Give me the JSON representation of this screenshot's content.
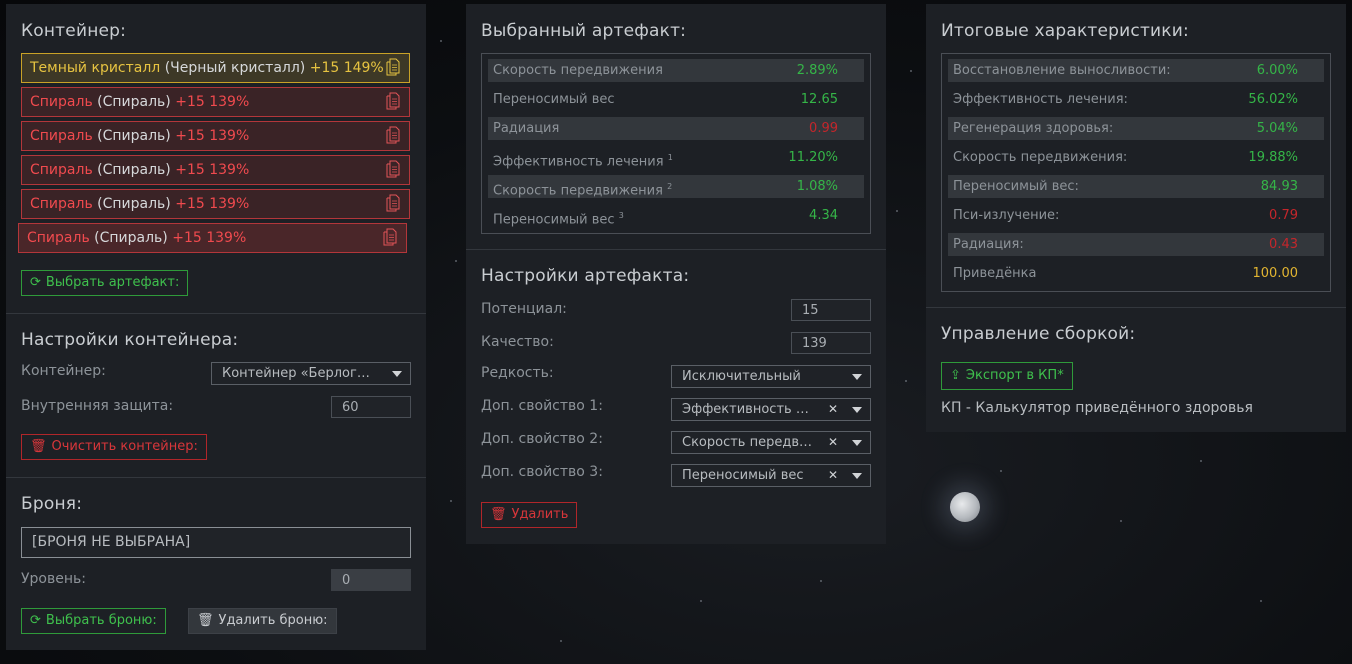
{
  "container": {
    "title": "Контейнер:",
    "items": [
      {
        "name": "Темный кристалл",
        "sub": "(Черный кристалл)",
        "pct": "+15 149%",
        "type": "gold"
      },
      {
        "name": "Спираль",
        "sub": "(Спираль)",
        "pct": "+15 139%",
        "type": "red"
      },
      {
        "name": "Спираль",
        "sub": "(Спираль)",
        "pct": "+15 139%",
        "type": "red"
      },
      {
        "name": "Спираль",
        "sub": "(Спираль)",
        "pct": "+15 139%",
        "type": "red"
      },
      {
        "name": "Спираль",
        "sub": "(Спираль)",
        "pct": "+15 139%",
        "type": "red"
      },
      {
        "name": "Спираль",
        "sub": "(Спираль)",
        "pct": "+15 139%",
        "type": "red"
      }
    ],
    "select_button": "Выбрать артефакт:"
  },
  "container_settings": {
    "title": "Настройки контейнера:",
    "container_label": "Контейнер:",
    "container_value": "Контейнер «Берлога...",
    "protection_label": "Внутренняя защита:",
    "protection_value": "60",
    "clear_button": "Очистить контейнер:"
  },
  "armor": {
    "title": "Броня:",
    "value": "[БРОНЯ НЕ ВЫБРАНА]",
    "level_label": "Уровень:",
    "level_value": "0",
    "select_button": "Выбрать броню:",
    "delete_button": "Удалить броню:"
  },
  "selected_artifact": {
    "title": "Выбранный артефакт:",
    "stats": [
      {
        "label": "Скорость передвижения",
        "sup": "",
        "value": "2.89%",
        "color": "green"
      },
      {
        "label": "Переносимый вес",
        "sup": "",
        "value": "12.65",
        "color": "green"
      },
      {
        "label": "Радиация",
        "sup": "",
        "value": "0.99",
        "color": "red"
      },
      {
        "label": "Эффективность лечения",
        "sup": "1",
        "value": "11.20%",
        "color": "green"
      },
      {
        "label": "Скорость передвижения",
        "sup": "2",
        "value": "1.08%",
        "color": "green"
      },
      {
        "label": "Переносимый вес",
        "sup": "3",
        "value": "4.34",
        "color": "green"
      }
    ]
  },
  "artifact_settings": {
    "title": "Настройки артефакта:",
    "potential_label": "Потенциал:",
    "potential_value": "15",
    "quality_label": "Качество:",
    "quality_value": "139",
    "rarity_label": "Редкость:",
    "rarity_value": "Исключительный",
    "extra1_label": "Доп. свойство 1:",
    "extra1_value": "Эффективность ле...",
    "extra2_label": "Доп. свойство 2:",
    "extra2_value": "Скорость передви...",
    "extra3_label": "Доп. свойство 3:",
    "extra3_value": "Переносимый вес",
    "delete_button": "Удалить"
  },
  "totals": {
    "title": "Итоговые характеристики:",
    "stats": [
      {
        "label": "Восстановление выносливости:",
        "value": "6.00%",
        "color": "green"
      },
      {
        "label": "Эффективность лечения:",
        "value": "56.02%",
        "color": "green"
      },
      {
        "label": "Регенерация здоровья:",
        "value": "5.04%",
        "color": "green"
      },
      {
        "label": "Скорость передвижения:",
        "value": "19.88%",
        "color": "green"
      },
      {
        "label": "Переносимый вес:",
        "value": "84.93",
        "color": "green"
      },
      {
        "label": "Пси-излучение:",
        "value": "0.79",
        "color": "red"
      },
      {
        "label": "Радиация:",
        "value": "0.43",
        "color": "red"
      },
      {
        "label": "Приведёнка",
        "value": "100.00",
        "color": "yellow"
      }
    ]
  },
  "build": {
    "title": "Управление сборкой:",
    "export_button": "Экспорт в КП*",
    "note": "КП - Калькулятор приведённого здоровья"
  }
}
